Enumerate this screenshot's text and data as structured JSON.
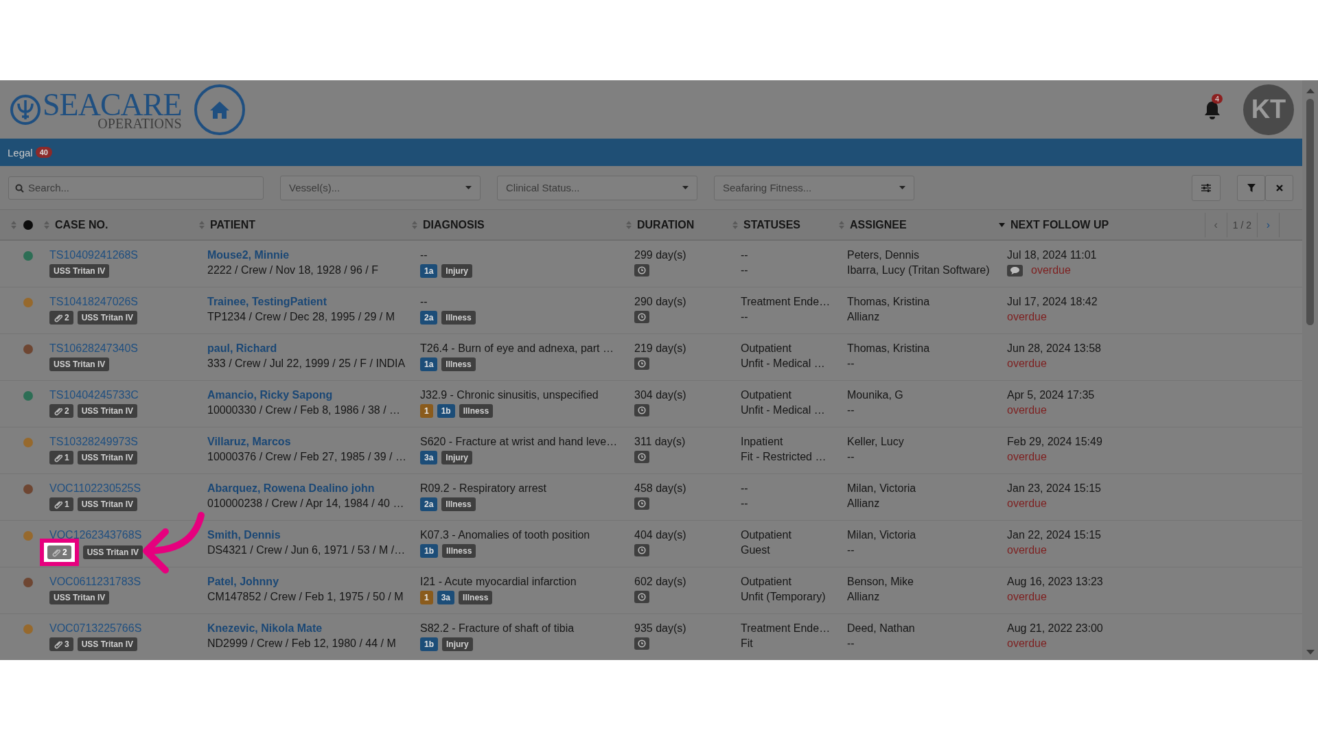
{
  "header": {
    "logo_text": "SEACARE",
    "logo_subtext": "OPERATIONS",
    "notification_count": "4",
    "avatar_initials": "KT"
  },
  "nav": {
    "label": "Legal",
    "count": "40"
  },
  "filters": {
    "search": {
      "placeholder": "Search..."
    },
    "dropdowns": [
      {
        "placeholder": "Vessel(s)..."
      },
      {
        "placeholder": "Clinical Status..."
      },
      {
        "placeholder": "Seafaring Fitness..."
      }
    ]
  },
  "table": {
    "columns": [
      {
        "label": "CASE NO.",
        "sorted": false
      },
      {
        "label": "PATIENT",
        "sorted": false
      },
      {
        "label": "DIAGNOSIS",
        "sorted": false
      },
      {
        "label": "DURATION",
        "sorted": false
      },
      {
        "label": "STATUSES",
        "sorted": false
      },
      {
        "label": "ASSIGNEE",
        "sorted": false
      },
      {
        "label": "NEXT FOLLOW UP",
        "sorted": true
      }
    ],
    "pagination": {
      "prev": "‹",
      "page": "1 / 2",
      "next": "›"
    },
    "rows": [
      {
        "color": "#2d6e55",
        "case_no": "TS10409241268S",
        "vessel": "USS Tritan IV",
        "patient": "Mouse2, Minnie",
        "details": "2222 / Crew / Nov 18, 1928 / 96 / F",
        "diagnosis": "--",
        "badges": [
          {
            "kind": "class",
            "text": "1a"
          },
          {
            "kind": "type",
            "text": "Injury"
          }
        ],
        "duration": "299 day(s)",
        "status_1": "--",
        "status_2": "--",
        "assignee_1": "Peters, Dennis",
        "assignee_2": "Ibarra, Lucy (Tritan Software)",
        "follow_up": "Jul 18, 2024 11:01",
        "comment": true,
        "overdue": "overdue"
      },
      {
        "color": "#96692d",
        "case_no": "TS10418247026S",
        "attachments": {
          "count": "2",
          "highlighted": false
        },
        "vessel": "USS Tritan IV",
        "patient": "Trainee, TestingPatient",
        "details": "TP1234 / Crew / Dec 28, 1995 / 29 / M",
        "diagnosis": "--",
        "badges": [
          {
            "kind": "class",
            "text": "2a"
          },
          {
            "kind": "type",
            "text": "Illness"
          }
        ],
        "duration": "290 day(s)",
        "status_1": "Treatment Ende…",
        "status_2": "--",
        "assignee_1": "Thomas, Kristina",
        "assignee_2": "Allianz",
        "follow_up": "Jul 17, 2024 18:42",
        "comment": false,
        "overdue": "overdue"
      },
      {
        "color": "#6e4632",
        "case_no": "TS10628247340S",
        "vessel": "USS Tritan IV",
        "patient": "paul, Richard",
        "details": "333 / Crew / Jul 22, 1999 / 25 / F / INDIA",
        "diagnosis": "T26.4 - Burn of eye and adnexa, part …",
        "badges": [
          {
            "kind": "class",
            "text": "1a"
          },
          {
            "kind": "type",
            "text": "Illness"
          }
        ],
        "duration": "219 day(s)",
        "status_1": "Outpatient",
        "status_2": "Unfit - Medical …",
        "assignee_1": "Thomas, Kristina",
        "assignee_2": "--",
        "follow_up": "Jun 28, 2024 13:58",
        "comment": false,
        "overdue": "overdue"
      },
      {
        "color": "#2d6e55",
        "case_no": "TS10404245733C",
        "attachments": {
          "count": "2",
          "highlighted": false
        },
        "vessel": "USS Tritan IV",
        "patient": "Amancio, Ricky Sapong",
        "details": "10000330 / Crew / Feb 8, 1986 / 38 / …",
        "diagnosis": "J32.9 - Chronic sinusitis, unspecified",
        "badges": [
          {
            "kind": "priority",
            "text": "1"
          },
          {
            "kind": "class",
            "text": "1b"
          },
          {
            "kind": "type",
            "text": "Illness"
          }
        ],
        "duration": "304 day(s)",
        "status_1": "Outpatient",
        "status_2": "Unfit - Medical …",
        "assignee_1": "Mounika, G",
        "assignee_2": "--",
        "follow_up": "Apr 5, 2024 17:35",
        "comment": false,
        "overdue": "overdue"
      },
      {
        "color": "#96692d",
        "case_no": "TS10328249973S",
        "attachments": {
          "count": "1",
          "highlighted": false
        },
        "vessel": "USS Tritan IV",
        "patient": "Villaruz, Marcos",
        "details": "10000376 / Crew / Feb 27, 1985 / 39 / …",
        "diagnosis": "S620 - Fracture at wrist and hand leve…",
        "badges": [
          {
            "kind": "class",
            "text": "3a"
          },
          {
            "kind": "type",
            "text": "Injury"
          }
        ],
        "duration": "311 day(s)",
        "status_1": "Inpatient",
        "status_2": "Fit - Restricted …",
        "assignee_1": "Keller, Lucy",
        "assignee_2": "--",
        "follow_up": "Feb 29, 2024 15:49",
        "comment": false,
        "overdue": "overdue"
      },
      {
        "color": "#6e4632",
        "case_no": "VOC1102230525S",
        "attachments": {
          "count": "1",
          "highlighted": false
        },
        "vessel": "USS Tritan IV",
        "patient": "Abarquez, Rowena Dealino john",
        "details": "010000238 / Crew / Apr 14, 1984 / 40 …",
        "diagnosis": "R09.2 - Respiratory arrest",
        "badges": [
          {
            "kind": "class",
            "text": "2a"
          },
          {
            "kind": "type",
            "text": "Illness"
          }
        ],
        "duration": "458 day(s)",
        "status_1": "--",
        "status_2": "--",
        "assignee_1": "Milan, Victoria",
        "assignee_2": "Allianz",
        "follow_up": "Jan 23, 2024 15:15",
        "comment": false,
        "overdue": "overdue"
      },
      {
        "color": "#96692d",
        "case_no": "VOC1262343768S",
        "attachments": {
          "count": "2",
          "highlighted": true
        },
        "vessel": "USS Tritan IV",
        "patient": "Smith, Dennis",
        "details": "DS4321 / Crew / Jun 6, 1971 / 53 / M /…",
        "diagnosis": "K07.3 - Anomalies of tooth position",
        "badges": [
          {
            "kind": "class",
            "text": "1b"
          },
          {
            "kind": "type",
            "text": "Illness"
          }
        ],
        "duration": "404 day(s)",
        "status_1": "Outpatient",
        "status_2": "Guest",
        "assignee_1": "Milan, Victoria",
        "assignee_2": "--",
        "follow_up": "Jan 22, 2024 15:15",
        "comment": false,
        "overdue": "overdue"
      },
      {
        "color": "#6e4632",
        "case_no": "VOC0611231783S",
        "vessel": "USS Tritan IV",
        "patient": "Patel, Johnny",
        "details": "CM147852 / Crew / Feb 1, 1975 / 50 / M",
        "diagnosis": "I21 - Acute myocardial infarction",
        "badges": [
          {
            "kind": "priority",
            "text": "1"
          },
          {
            "kind": "class",
            "text": "3a"
          },
          {
            "kind": "type",
            "text": "Illness"
          }
        ],
        "duration": "602 day(s)",
        "status_1": "Outpatient",
        "status_2": "Unfit (Temporary)",
        "assignee_1": "Benson, Mike",
        "assignee_2": "Allianz",
        "follow_up": "Aug 16, 2023 13:23",
        "comment": false,
        "overdue": "overdue"
      },
      {
        "color": "#96692d",
        "case_no": "VOC0713225766S",
        "attachments": {
          "count": "3",
          "highlighted": false
        },
        "vessel": "USS Tritan IV",
        "patient": "Knezevic, Nikola Mate",
        "details": "ND2999 / Crew / Feb 12, 1980 / 44 / M",
        "diagnosis": "S82.2 - Fracture of shaft of tibia",
        "badges": [
          {
            "kind": "class",
            "text": "1b"
          },
          {
            "kind": "type",
            "text": "Injury"
          }
        ],
        "duration": "935 day(s)",
        "status_1": "Treatment Ende…",
        "status_2": "Fit",
        "assignee_1": "Deed, Nathan",
        "assignee_2": "--",
        "follow_up": "Aug 21, 2022 23:00",
        "comment": false,
        "overdue": "overdue"
      }
    ]
  }
}
